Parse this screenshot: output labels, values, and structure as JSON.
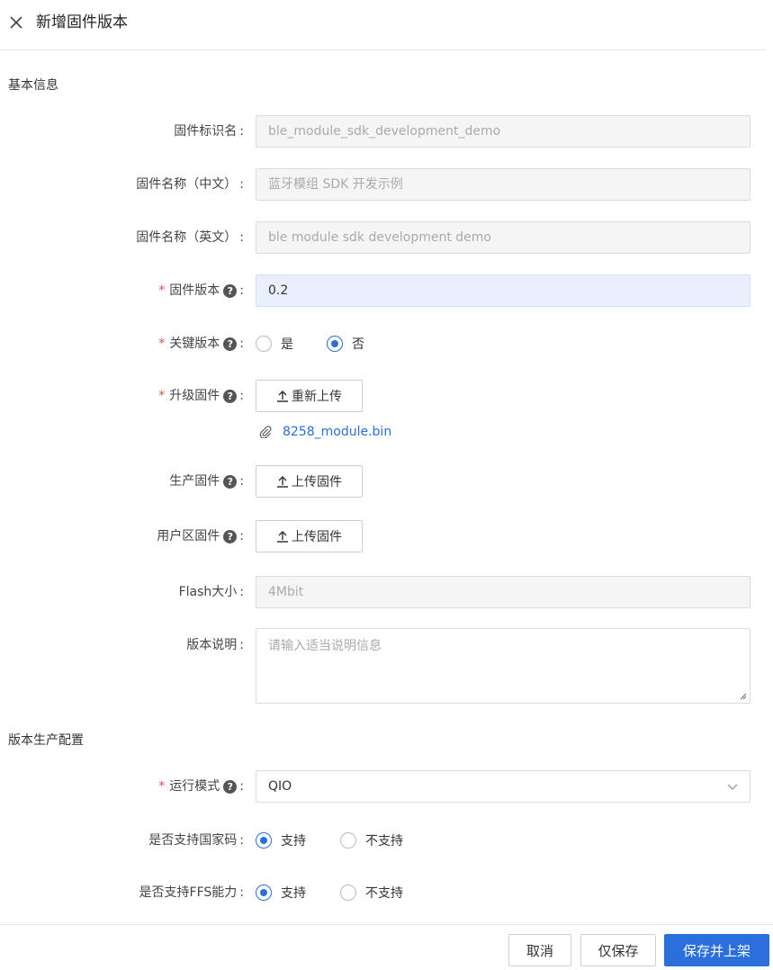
{
  "header": {
    "title": "新增固件版本"
  },
  "sections": {
    "basic": "基本信息",
    "production": "版本生产配置"
  },
  "fields": {
    "firmware_id": {
      "label": "固件标识名",
      "value": "ble_module_sdk_development_demo"
    },
    "name_zh": {
      "label": "固件名称（中文）",
      "value": "蓝牙模组 SDK 开发示例"
    },
    "name_en": {
      "label": "固件名称（英文）",
      "value": "ble module sdk development demo"
    },
    "version": {
      "label": "固件版本",
      "value": "0.2"
    },
    "key_version": {
      "label": "关键版本",
      "options": [
        "是",
        "否"
      ],
      "selected": "否"
    },
    "upgrade_firmware": {
      "label": "升级固件",
      "button": "重新上传",
      "file": "8258_module.bin"
    },
    "production_firmware": {
      "label": "生产固件",
      "button": "上传固件"
    },
    "user_area_firmware": {
      "label": "用户区固件",
      "button": "上传固件"
    },
    "flash_size": {
      "label": "Flash大小",
      "value": "4Mbit"
    },
    "description": {
      "label": "版本说明",
      "placeholder": "请输入适当说明信息"
    },
    "run_mode": {
      "label": "运行模式",
      "value": "QIO"
    },
    "country_code": {
      "label": "是否支持国家码",
      "options": [
        "支持",
        "不支持"
      ],
      "selected": "支持"
    },
    "ffs": {
      "label": "是否支持FFS能力",
      "options": [
        "支持",
        "不支持"
      ],
      "selected": "支持"
    }
  },
  "footer": {
    "cancel": "取消",
    "save": "仅保存",
    "save_publish": "保存并上架"
  },
  "colors": {
    "primary": "#2a6fdb",
    "required": "#e34d4d",
    "active_input_bg": "#e8f0fd"
  },
  "icons": {
    "close": "close-icon",
    "help": "question-icon",
    "upload": "upload-icon",
    "attachment": "paperclip-icon",
    "dropdown": "chevron-down-icon"
  }
}
